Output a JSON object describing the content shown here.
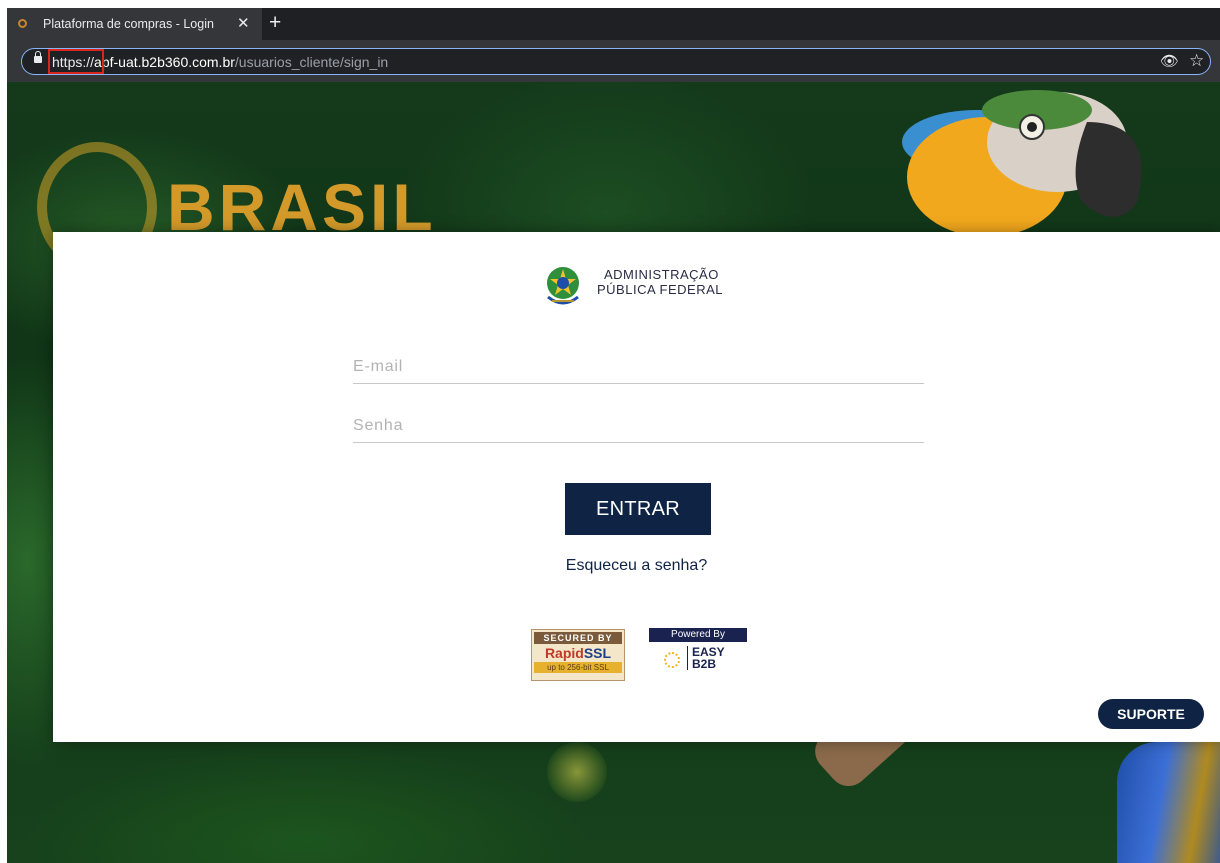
{
  "browser": {
    "tab_title": "Plataforma de compras - Login",
    "tab_close": "✕",
    "new_tab": "+",
    "url_scheme": "https://",
    "url_host": "apf-uat.b2b360.com.br",
    "url_path": "/usuarios_cliente/sign_in",
    "eye_icon": "👁",
    "star_icon": "☆"
  },
  "background": {
    "banner_text": "BRASIL"
  },
  "brand": {
    "line1": "ADMINISTRAÇÃO",
    "line2": "PÚBLICA FEDERAL"
  },
  "form": {
    "email_placeholder": "E-mail",
    "password_placeholder": "Senha",
    "submit_label": "ENTRAR",
    "forgot_label": "Esqueceu a senha?"
  },
  "badges": {
    "ssl_secured": "SECURED BY",
    "ssl_rapid": "Rapid",
    "ssl_ssl": "SSL",
    "ssl_strength": "up to 256-bit SSL",
    "easy_powered": "Powered By",
    "easy_line1": "EASY",
    "easy_line2": "B2B"
  },
  "support": {
    "label": "SUPORTE"
  },
  "colors": {
    "primary_navy": "#0f2445",
    "omnibox_focus": "#8ab4f8",
    "highlight_red": "#d9261c"
  }
}
